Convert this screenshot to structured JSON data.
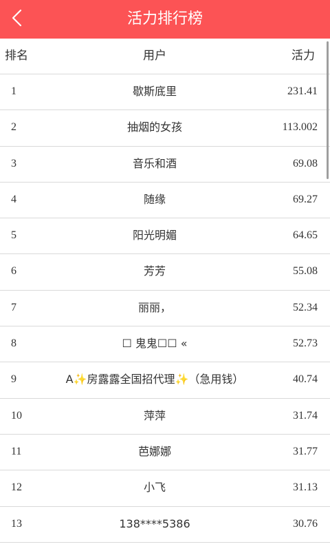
{
  "titlebar": {
    "title": "活力排行榜",
    "back_icon": "chevron-left-icon",
    "background_color": "#fc5355"
  },
  "table": {
    "columns": [
      "排名",
      "用户",
      "活力"
    ],
    "rows": [
      {
        "rank": "1",
        "user": "歇斯底里",
        "score": "231.41"
      },
      {
        "rank": "2",
        "user": "抽烟的女孩",
        "score": "113.002"
      },
      {
        "rank": "3",
        "user": "音乐和酒",
        "score": "69.08"
      },
      {
        "rank": "4",
        "user": "随缘",
        "score": "69.27"
      },
      {
        "rank": "5",
        "user": "阳光明媚",
        "score": "64.65"
      },
      {
        "rank": "6",
        "user": "芳芳",
        "score": "55.08"
      },
      {
        "rank": "7",
        "user": "丽丽，",
        "score": "52.34"
      },
      {
        "rank": "8",
        "user": "☐ 鬼鬼☐☐ «",
        "score": "52.73"
      },
      {
        "rank": "9",
        "user": "A✨房露露全国招代理✨（急用钱）",
        "score": "40.74"
      },
      {
        "rank": "10",
        "user": "萍萍",
        "score": "31.74"
      },
      {
        "rank": "11",
        "user": "芭娜娜",
        "score": "31.77"
      },
      {
        "rank": "12",
        "user": "小飞",
        "score": "31.13"
      },
      {
        "rank": "13",
        "user": "138****5386",
        "score": "30.76"
      }
    ]
  }
}
